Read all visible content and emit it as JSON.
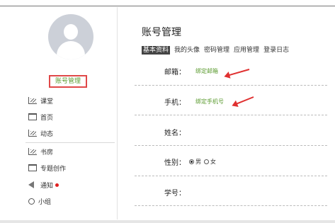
{
  "sidebar": {
    "account_button": "账号管理",
    "items": [
      {
        "label": "课堂",
        "icon": "chart-icon"
      },
      {
        "label": "首页",
        "icon": "window-icon"
      },
      {
        "label": "动态",
        "icon": "chart-icon"
      },
      {
        "label": "书房",
        "icon": "chart-icon"
      },
      {
        "label": "专题创作",
        "icon": "window-icon"
      },
      {
        "label": "通知",
        "icon": "speaker-icon",
        "badge_color": "#e02020"
      },
      {
        "label": "小组",
        "icon": "people-icon"
      }
    ]
  },
  "main": {
    "title": "账号管理",
    "tabs": [
      "基本资料",
      "我的头像",
      "密码管理",
      "应用管理",
      "登录日志"
    ],
    "active_tab": "基本资料",
    "fields": {
      "email_label": "邮箱：",
      "email_link": "绑定邮箱",
      "phone_label": "手机：",
      "phone_link": "绑定手机号",
      "name_label": "姓名：",
      "gender_label": "性别：",
      "gender_male": "男",
      "gender_female": "女",
      "gender_selected": "男",
      "student_id_label": "学号："
    }
  },
  "colors": {
    "accent_green": "#5a9a2e",
    "highlight_red": "#e04848"
  }
}
